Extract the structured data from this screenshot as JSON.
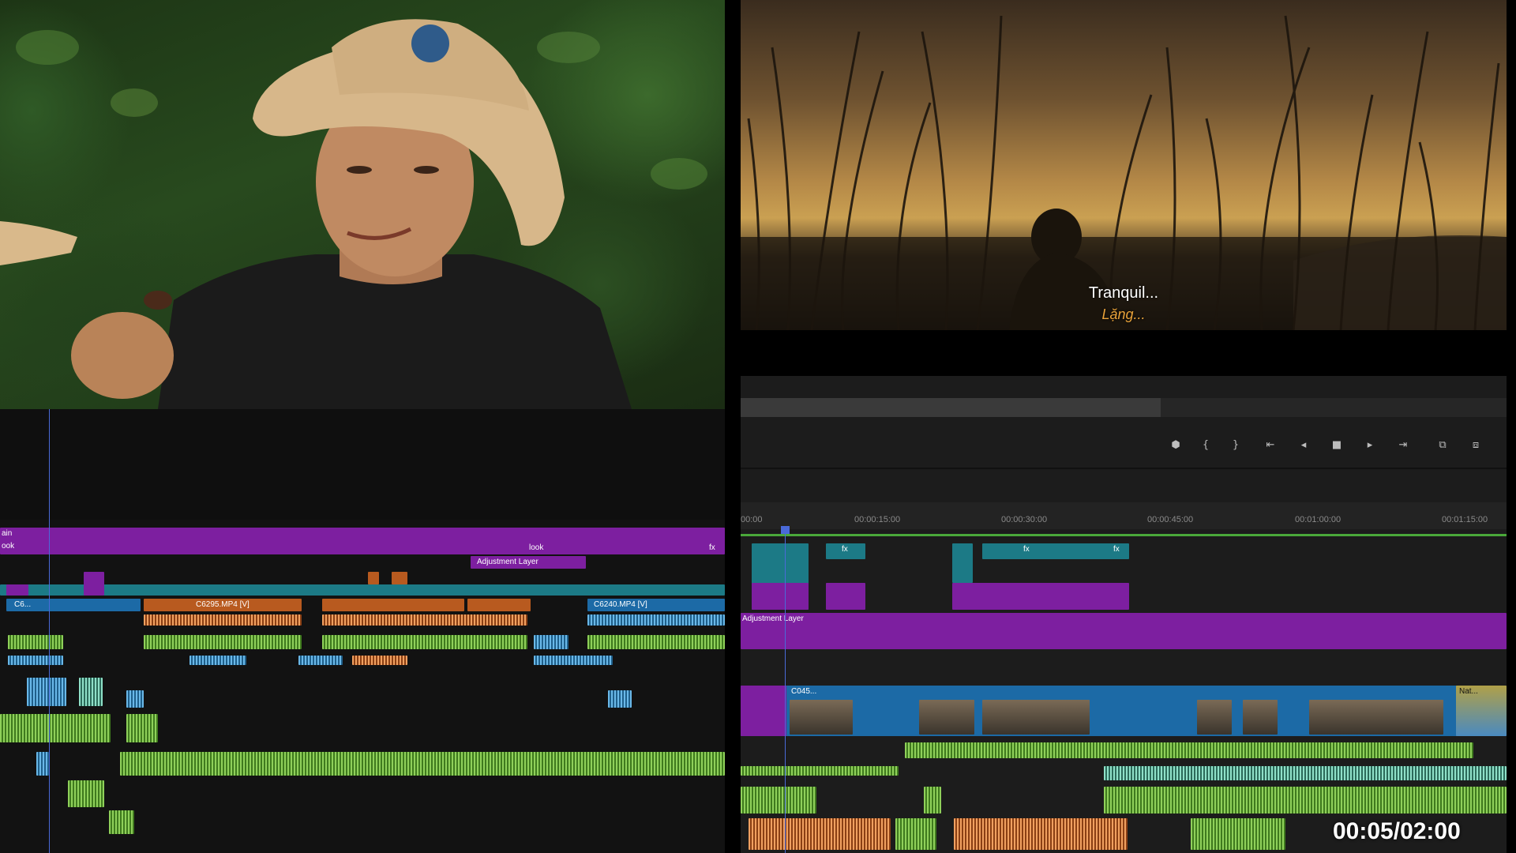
{
  "preview": {
    "subtitle_en": "Tranquil...",
    "subtitle_vi": "Lặng..."
  },
  "timeline_left": {
    "track_labels": [
      "ain",
      "ook"
    ],
    "adjustment_label": "Adjustment Layer",
    "look_label": "look",
    "fx": "fx",
    "clips": [
      "C6...",
      "C6295.MP4 [V]",
      "C6240.MP4 [V]"
    ]
  },
  "timeline_right": {
    "ruler": [
      "00:00",
      "00:00:15:00",
      "00:00:30:00",
      "00:00:45:00",
      "00:01:00:00",
      "00:01:15:00"
    ],
    "adjustment_label": "Adjustment Layer",
    "fx": "fx",
    "clips": [
      "C045...",
      "Nat..."
    ],
    "controls": [
      "marker-icon",
      "mark-in-icon",
      "mark-out-icon",
      "go-to-in-icon",
      "step-back-icon",
      "stop-icon",
      "step-forward-icon",
      "go-to-out-icon",
      "insert-icon",
      "overwrite-icon"
    ]
  },
  "overlay": {
    "timecode": "00:05/02:00"
  },
  "colors": {
    "purple": "#7d1fa0",
    "teal": "#1c7a86",
    "blue": "#1c6aa6",
    "orange": "#b85a1f",
    "audio_green": "#8fd05a",
    "playhead": "#4a6ad8",
    "subtitle_vi": "#e8a23a"
  }
}
